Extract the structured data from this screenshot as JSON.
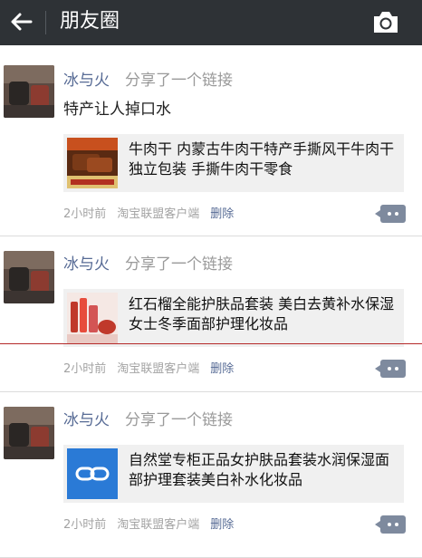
{
  "header": {
    "title": "朋友圈",
    "back_icon": "back-arrow-icon",
    "camera_icon": "camera-icon"
  },
  "posts": [
    {
      "name": "冰与火",
      "action": "分享了一个链接",
      "text": "特产让人掉口水",
      "link_title": "牛肉干 内蒙古牛肉干特产手撕风干牛肉干独立包装 手撕牛肉干零食",
      "time": "2小时前",
      "source": "淘宝联盟客户端",
      "delete": "删除"
    },
    {
      "name": "冰与火",
      "action": "分享了一个链接",
      "text": "",
      "link_title": "红石榴全能护肤品套装 美白去黄补水保湿女士冬季面部护理化妆品",
      "time": "2小时前",
      "source": "淘宝联盟客户端",
      "delete": "删除"
    },
    {
      "name": "冰与火",
      "action": "分享了一个链接",
      "text": "",
      "link_title": "自然堂专柜正品女护肤品套装水润保湿面部护理套装美白补水化妆品",
      "time": "2小时前",
      "source": "淘宝联盟客户端",
      "delete": "删除"
    }
  ],
  "colors": {
    "topbar": "#2e3236",
    "name_link": "#576b95",
    "link_icon_bg": "#2a7ad6"
  }
}
